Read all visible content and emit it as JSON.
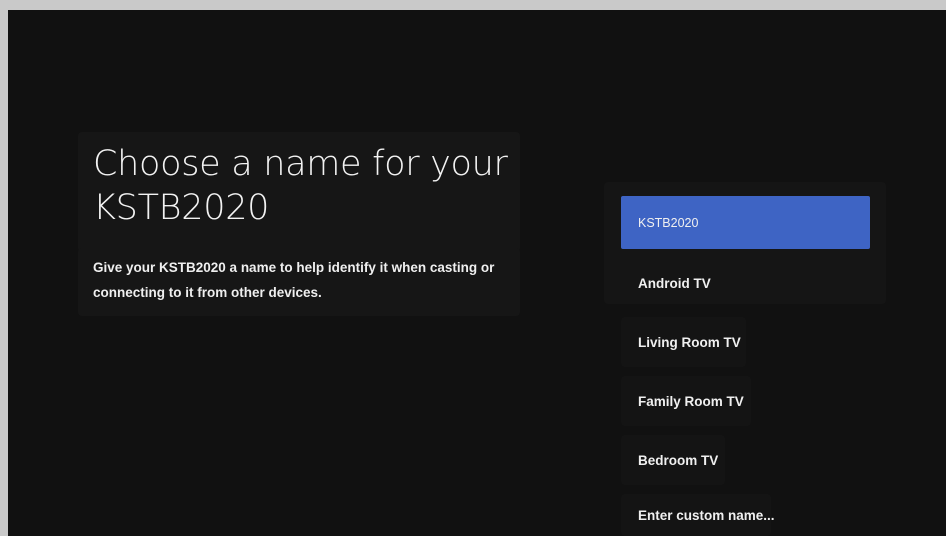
{
  "setup": {
    "title": "Choose a name for your KSTB2020",
    "description": "Give your KSTB2020 a name to help identify it when casting or connecting to it from other devices."
  },
  "name_options": [
    {
      "label": "KSTB2020",
      "selected": true
    },
    {
      "label": "Android TV",
      "selected": false
    },
    {
      "label": "Living Room TV",
      "selected": false
    },
    {
      "label": "Family Room TV",
      "selected": false
    },
    {
      "label": "Bedroom TV",
      "selected": false
    },
    {
      "label": "Enter custom name...",
      "selected": false
    }
  ],
  "colors": {
    "background": "#111111",
    "selected": "#3e64c4",
    "text": "#f0f0f0"
  }
}
